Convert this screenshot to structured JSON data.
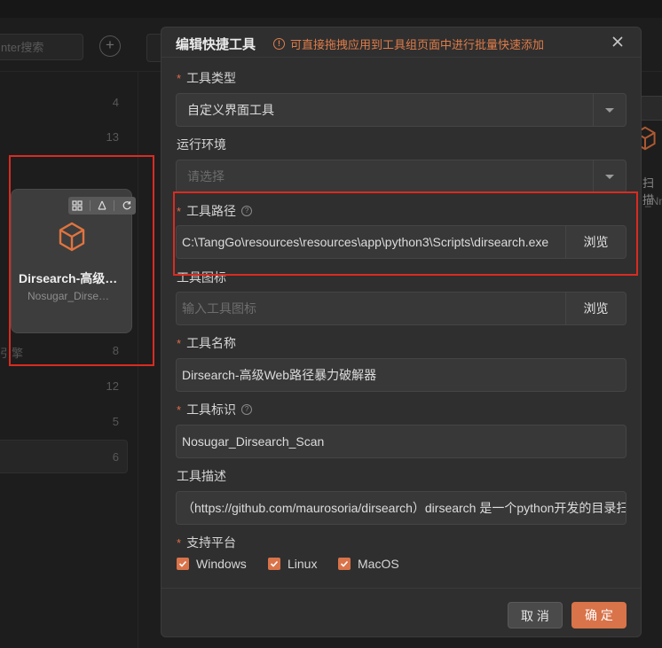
{
  "background": {
    "search_placeholder": "nter搜索",
    "add_icon": "plus-circle-icon",
    "counts": [
      "4",
      "13",
      "8",
      "12",
      "5",
      "6"
    ],
    "fragment_text": "引擎",
    "card": {
      "title": "Dirsearch-高级…",
      "subtitle": "Nosugar_Dirse…",
      "icon": "cube-icon",
      "action_icons": [
        "copy-icon",
        "share-icon",
        "refresh-icon"
      ]
    },
    "right_card": {
      "title_fragment": "扫描",
      "subtitle_fragment": "_Nm"
    }
  },
  "modal": {
    "title": "编辑快捷工具",
    "tip": "可直接拖拽应用到工具组页面中进行批量快速添加",
    "fields": {
      "tool_type": {
        "label": "工具类型",
        "required": true,
        "value": "自定义界面工具"
      },
      "runtime": {
        "label": "运行环境",
        "required": false,
        "placeholder": "请选择"
      },
      "tool_path": {
        "label": "工具路径",
        "required": true,
        "value": "C:\\TangGo\\resources\\resources\\app\\python3\\Scripts\\dirsearch.exe",
        "button": "浏览"
      },
      "tool_icon": {
        "label": "工具图标",
        "required": false,
        "placeholder": "输入工具图标",
        "button": "浏览"
      },
      "tool_name": {
        "label": "工具名称",
        "required": true,
        "value": "Dirsearch-高级Web路径暴力破解器"
      },
      "tool_id": {
        "label": "工具标识",
        "required": true,
        "value": "Nosugar_Dirsearch_Scan"
      },
      "tool_desc": {
        "label": "工具描述",
        "required": false,
        "value": "（https://github.com/maurosoria/dirsearch）dirsearch 是一个python开发的目录扫描工具"
      },
      "platforms": {
        "label": "支持平台",
        "required": true,
        "options": [
          {
            "label": "Windows",
            "checked": true
          },
          {
            "label": "Linux",
            "checked": true
          },
          {
            "label": "MacOS",
            "checked": true
          }
        ]
      }
    },
    "buttons": {
      "cancel": "取 消",
      "ok": "确 定"
    }
  },
  "colors": {
    "accent": "#d9734a",
    "highlight_box": "#d92b22",
    "required_star": "#e06c4a"
  }
}
